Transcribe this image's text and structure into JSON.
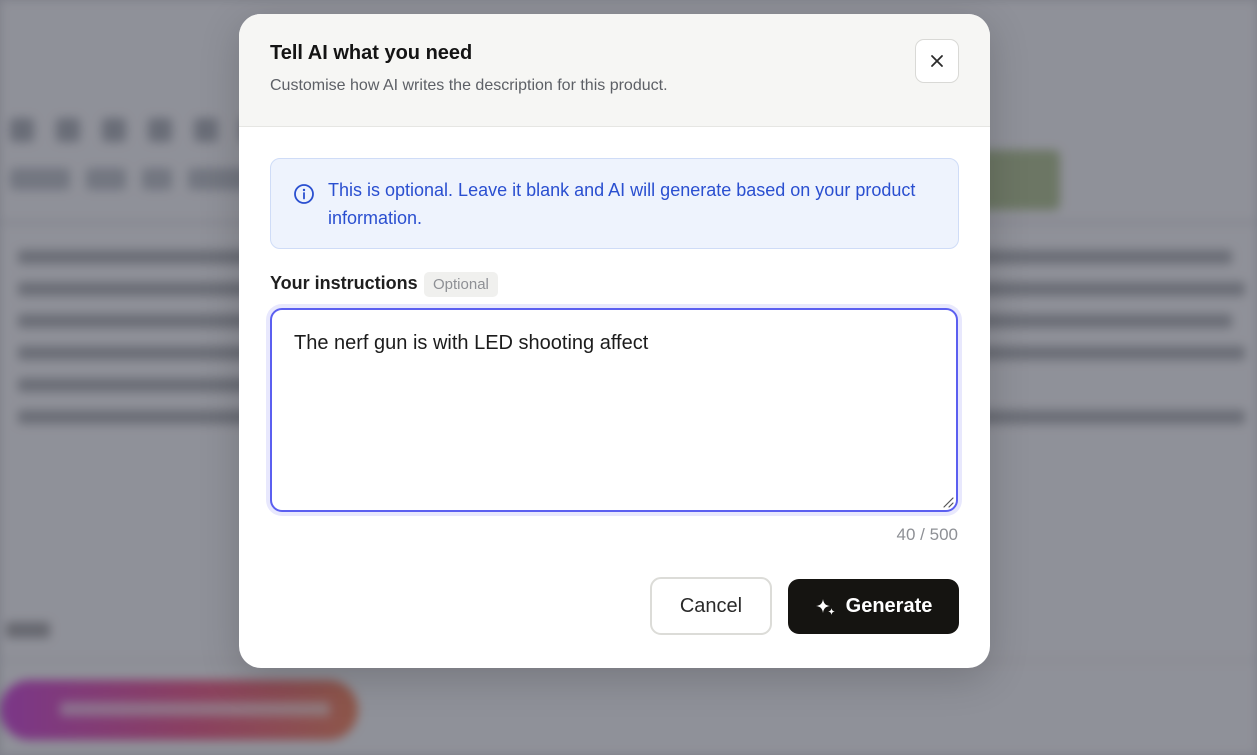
{
  "modal": {
    "title": "Tell AI what you need",
    "subtitle": "Customise how AI writes the description for this product.",
    "close_icon": "close-icon"
  },
  "info": {
    "icon": "info-icon",
    "text": "This is optional. Leave it blank and AI will generate based on your product information."
  },
  "instructions": {
    "label": "Your instructions",
    "badge": "Optional",
    "value": "The nerf gun is with LED shooting affect",
    "char_count": "40 / 500"
  },
  "actions": {
    "cancel_label": "Cancel",
    "generate_label": "Generate",
    "generate_icon": "sparkle-icon"
  },
  "colors": {
    "accent": "#5b5ff0",
    "info_text": "#2a4fd0",
    "info_bg": "#eef3fd",
    "primary_button": "#151411"
  }
}
